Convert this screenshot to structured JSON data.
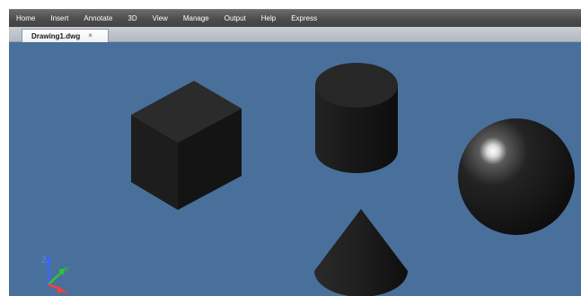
{
  "menu": {
    "items": [
      "Home",
      "Insert",
      "Annotate",
      "3D",
      "View",
      "Manage",
      "Output",
      "Help",
      "Express"
    ]
  },
  "tabs": {
    "active_label": "Drawing1.dwg",
    "close_glyph": "×"
  },
  "viewport": {
    "background": "#49709a",
    "objects": [
      "box",
      "cylinder",
      "sphere",
      "cone"
    ],
    "ucs_icon": {
      "axes": [
        "Z",
        "Y",
        "X"
      ],
      "colors": {
        "z": "#3a66ff",
        "y": "#2fc43a",
        "x": "#ff3b3b"
      }
    }
  }
}
